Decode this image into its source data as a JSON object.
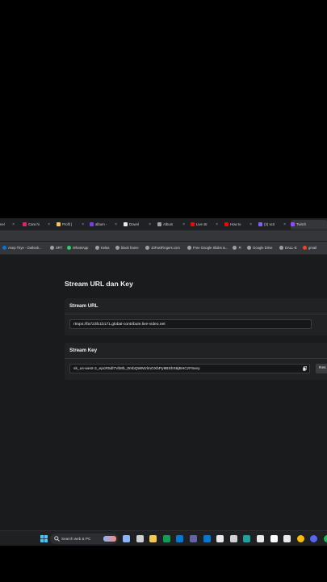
{
  "browser": {
    "tabs": [
      {
        "label": "nel",
        "color": "#5f6368"
      },
      {
        "label": "Cara hi",
        "color": "#e0245e"
      },
      {
        "label": "Profil |",
        "color": "#f2c94c"
      },
      {
        "label": "album -",
        "color": "#7c3aed"
      },
      {
        "label": "Downl",
        "color": "#e8eaed"
      },
      {
        "label": "Album",
        "color": "#9aa0a6"
      },
      {
        "label": "Live str",
        "color": "#ff0000"
      },
      {
        "label": "How to",
        "color": "#ff0000"
      },
      {
        "label": "(3) scri",
        "color": "#8b5cf6"
      },
      {
        "label": "Twitch",
        "color": "#9146ff"
      }
    ],
    "bookmarks": [
      {
        "label": "Asep Tirye - Outlook...",
        "color": "#0078d4"
      },
      {
        "label": "SRT",
        "color": "#9aa0a6"
      },
      {
        "label": "WhatsApp",
        "color": "#25d366"
      },
      {
        "label": "Kelas",
        "color": "#9aa0a6"
      },
      {
        "label": "black frame",
        "color": "#9aa0a6"
      },
      {
        "label": "10FastFingers.com",
        "color": "#9aa0a6"
      },
      {
        "label": "Free Google Slides &...",
        "color": "#9aa0a6"
      },
      {
        "label": "",
        "color": "#9aa0a6"
      },
      {
        "label": "Google Drive",
        "color": "#9aa0a6"
      },
      {
        "label": "DALL-E",
        "color": "#9aa0a6"
      },
      {
        "label": "gmail",
        "color": "#ea4335"
      }
    ]
  },
  "page": {
    "title": "Stream URL dan Key",
    "url_section": {
      "label": "Stream URL",
      "value": "rtmps://fa723fc1b171.global-contribute.live-video.net"
    },
    "key_section": {
      "label": "Stream Key",
      "value": "sk_us-west-2_epcR5dl7Vb8b_0mbQWMzlmGXbPy9BShS6jBHCzF6vey",
      "reset_label": "Res"
    }
  },
  "taskbar": {
    "search_placeholder": "Search web & PC",
    "apps": [
      {
        "icon": "widgets-icon",
        "color": "#8ab4f8"
      },
      {
        "icon": "taskview-icon",
        "color": "#cfd1d4"
      },
      {
        "icon": "file-explorer-icon",
        "color": "#f2c94c"
      },
      {
        "icon": "edge-icon",
        "color": "#0f9d58"
      },
      {
        "icon": "store-icon",
        "color": "#0078d4"
      },
      {
        "icon": "teams-icon",
        "color": "#6264a7"
      },
      {
        "icon": "calendar-icon",
        "color": "#0078d4"
      },
      {
        "icon": "photos-icon",
        "color": "#e8eaed"
      },
      {
        "icon": "camera-icon",
        "color": "#cfd1d4"
      },
      {
        "icon": "edge-browser-icon",
        "color": "#1da1a1"
      },
      {
        "icon": "mail-icon",
        "color": "#e8eaed"
      },
      {
        "icon": "tiktok-icon",
        "color": "#ffffff"
      },
      {
        "icon": "store2-icon",
        "color": "#e8eaed"
      },
      {
        "icon": "chrome-icon",
        "color": "#fbbc05"
      },
      {
        "icon": "discord-icon",
        "color": "#5865f2"
      },
      {
        "icon": "spotify-icon",
        "color": "#1db954"
      },
      {
        "icon": "chrome-active-icon",
        "color": "#ea4335"
      },
      {
        "icon": "settings-icon",
        "color": "#9aa0a6"
      }
    ]
  }
}
